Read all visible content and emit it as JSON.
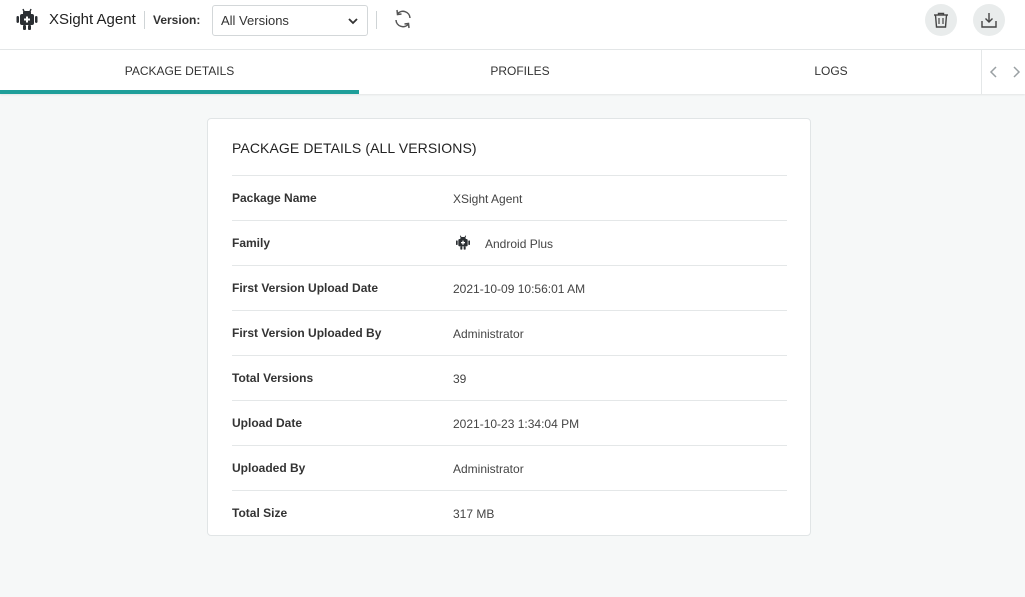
{
  "header": {
    "app_icon": "android-robot-icon",
    "app_title": "XSight Agent",
    "version_label": "Version:",
    "version_selected": "All Versions",
    "refresh_icon": "refresh-icon",
    "trash_icon": "trash-icon",
    "download_icon": "download-icon"
  },
  "tabs": [
    {
      "label": "PACKAGE DETAILS",
      "active": true
    },
    {
      "label": "PROFILES",
      "active": false
    },
    {
      "label": "LOGS",
      "active": false
    }
  ],
  "colors": {
    "accent": "#1f9f9a",
    "background": "#f6f8f8"
  },
  "details": {
    "title": "PACKAGE DETAILS (ALL VERSIONS)",
    "rows": [
      {
        "label": "Package Name",
        "value": "XSight Agent"
      },
      {
        "label": "Family",
        "value": "Android Plus",
        "icon": "android-robot-icon"
      },
      {
        "label": "First Version Upload Date",
        "value": "2021-10-09 10:56:01 AM"
      },
      {
        "label": "First Version Uploaded By",
        "value": "Administrator"
      },
      {
        "label": "Total Versions",
        "value": "39"
      },
      {
        "label": "Upload Date",
        "value": "2021-10-23 1:34:04 PM"
      },
      {
        "label": "Uploaded By",
        "value": "Administrator"
      },
      {
        "label": "Total Size",
        "value": "317 MB"
      }
    ]
  }
}
